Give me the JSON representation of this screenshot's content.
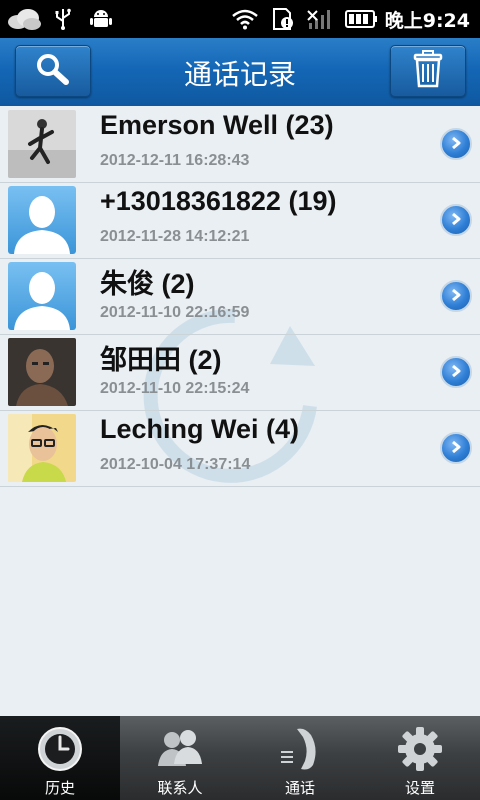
{
  "status_bar": {
    "time": "晚上9:24",
    "icons": [
      "weather-cloud-icon",
      "usb-icon",
      "android-icon",
      "wifi-icon",
      "sd-card-alert-icon",
      "signal-icon",
      "battery-icon"
    ]
  },
  "header": {
    "title": "通话记录",
    "search_icon": "search-icon",
    "delete_icon": "trash-icon"
  },
  "calls": [
    {
      "name": "Emerson Well (23)",
      "date": "2012-12-11 16:28:43",
      "avatar": "photo-man-jumping"
    },
    {
      "name": "+13018361822 (19)",
      "date": "2012-11-28 14:12:21",
      "avatar": "default-silhouette"
    },
    {
      "name": "朱俊 (2)",
      "date": "2012-11-10 22:16:59",
      "avatar": "default-silhouette"
    },
    {
      "name": "邹田田 (2)",
      "date": "2012-11-10 22:15:24",
      "avatar": "photo-man-dark"
    },
    {
      "name": "Leching Wei (4)",
      "date": "2012-10-04 17:37:14",
      "avatar": "photo-man-glasses"
    }
  ],
  "tabs": [
    {
      "label": "历史",
      "icon": "clock-icon",
      "active": true
    },
    {
      "label": "联系人",
      "icon": "contacts-icon",
      "active": false
    },
    {
      "label": "通话",
      "icon": "phone-icon",
      "active": false
    },
    {
      "label": "设置",
      "icon": "gear-icon",
      "active": false
    }
  ],
  "colors": {
    "header_blue": "#1467b6",
    "list_bg": "#e9eff2",
    "arrow_blue": "#2f7fd6",
    "tabbar_dark": "#2a2c2e"
  }
}
